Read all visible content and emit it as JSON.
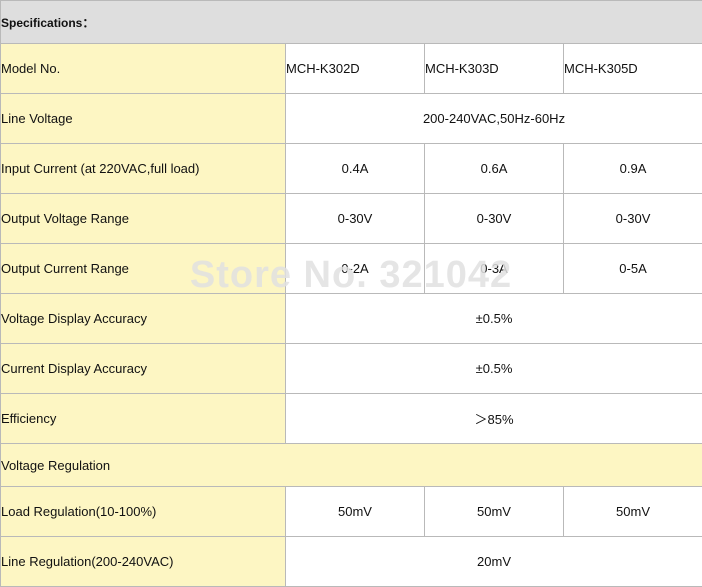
{
  "header": "Specifications：",
  "rows": {
    "model": {
      "label": "Model No.",
      "v1": "MCH-K302D",
      "v2": "MCH-K303D",
      "v3": "MCH-K305D"
    },
    "line_voltage": {
      "label": "Line Voltage",
      "value": "200-240VAC,50Hz-60Hz"
    },
    "input_current": {
      "label": "Input Current (at 220VAC,full load)",
      "v1": "0.4A",
      "v2": "0.6A",
      "v3": "0.9A"
    },
    "output_voltage": {
      "label": "Output Voltage Range",
      "v1": "0-30V",
      "v2": "0-30V",
      "v3": "0-30V"
    },
    "output_current": {
      "label": "Output Current Range",
      "v1": "0-2A",
      "v2": "0-3A",
      "v3": "0-5A"
    },
    "voltage_display": {
      "label": "Voltage Display Accuracy",
      "value": "±0.5%"
    },
    "current_display": {
      "label": "Current Display Accuracy",
      "value": "±0.5%"
    },
    "efficiency": {
      "label": "Efficiency",
      "value": "＞85%"
    },
    "voltage_regulation": {
      "label": "Voltage Regulation"
    },
    "load_regulation": {
      "label": "Load Regulation(10-100%)",
      "v1": "50mV",
      "v2": "50mV",
      "v3": "50mV"
    },
    "line_regulation": {
      "label": "Line Regulation(200-240VAC)",
      "value": "20mV"
    }
  },
  "watermark": "Store No. 321042",
  "colors": {
    "label_bg": "#fdf6c3",
    "header_bg": "#dedede",
    "border": "#b9b9b9",
    "watermark": "#e1e1e1"
  }
}
